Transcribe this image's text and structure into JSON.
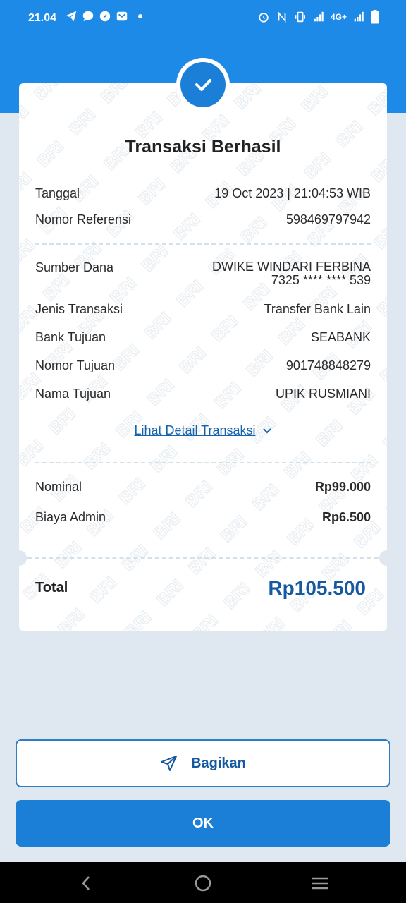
{
  "status_bar": {
    "time": "21.04",
    "network": "4G+"
  },
  "receipt": {
    "title": "Transaksi Berhasil",
    "rows_top": [
      {
        "label": "Tanggal",
        "value": "19 Oct 2023 | 21:04:53 WIB"
      },
      {
        "label": "Nomor Referensi",
        "value": "598469797942"
      }
    ],
    "source": {
      "label": "Sumber Dana",
      "name": "DWIKE WINDARI FERBINA",
      "account": "7325 **** **** 539"
    },
    "rows_mid": [
      {
        "label": "Jenis Transaksi",
        "value": "Transfer Bank Lain"
      },
      {
        "label": "Bank Tujuan",
        "value": "SEABANK"
      },
      {
        "label": "Nomor Tujuan",
        "value": "901748848279"
      },
      {
        "label": "Nama Tujuan",
        "value": "UPIK RUSMIANI"
      }
    ],
    "detail_link": "Lihat Detail Transaksi",
    "rows_amount": [
      {
        "label": "Nominal",
        "value": "Rp99.000"
      },
      {
        "label": "Biaya Admin",
        "value": "Rp6.500"
      }
    ],
    "total_label": "Total",
    "total_value": "Rp105.500",
    "watermark_text": "BRI"
  },
  "buttons": {
    "share": "Bagikan",
    "ok": "OK"
  },
  "colors": {
    "primary": "#1b7fd8",
    "header": "#1d8ae8",
    "accent_text": "#15599f",
    "background": "#dfe8f0"
  }
}
